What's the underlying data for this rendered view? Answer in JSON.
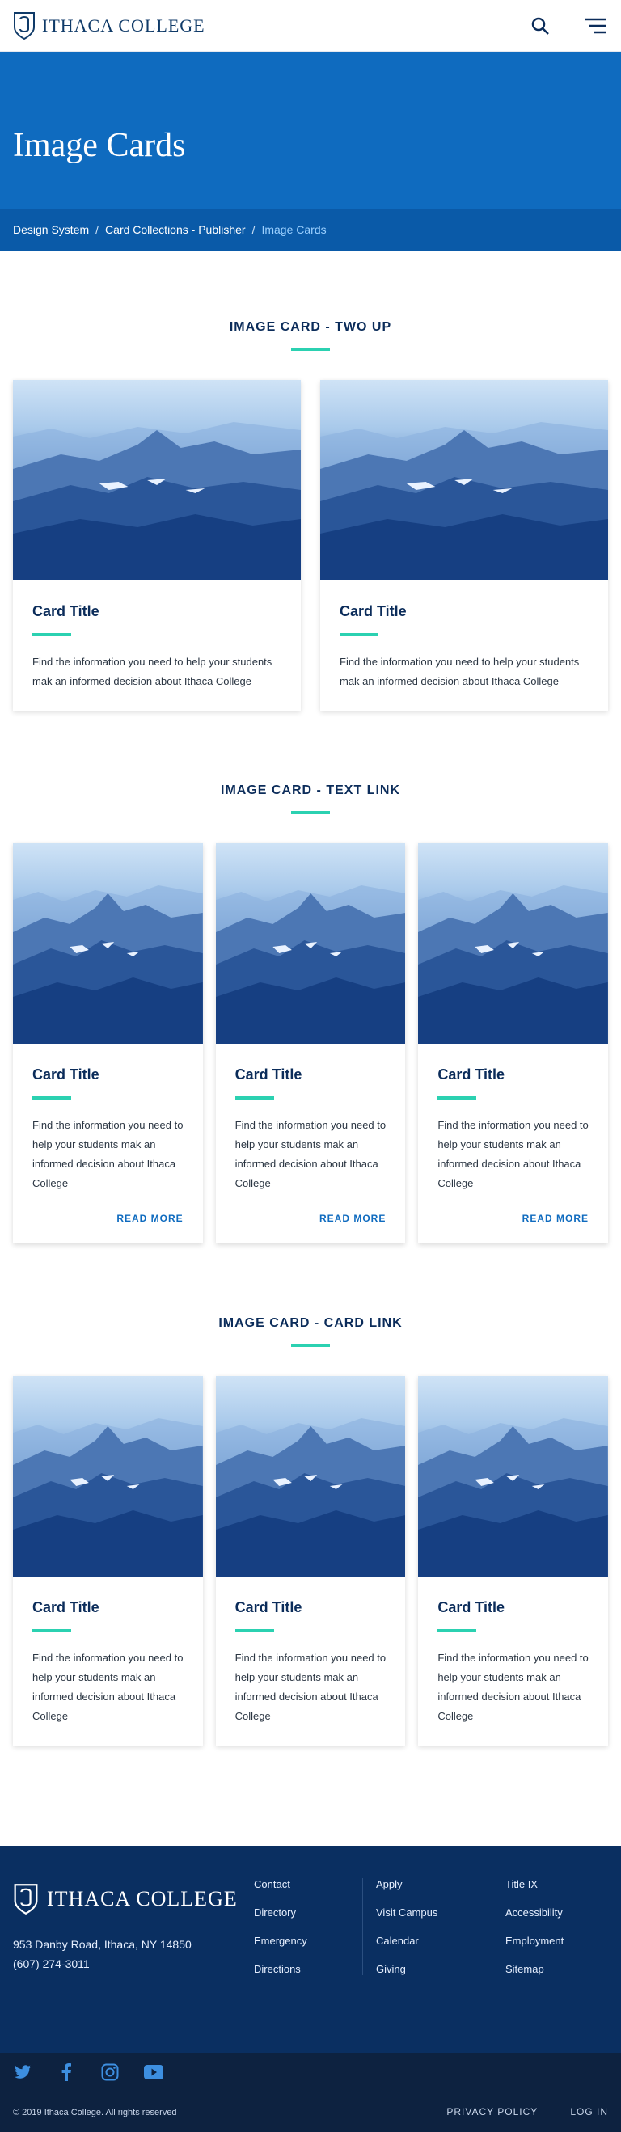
{
  "header": {
    "brand": "ITHACA COLLEGE",
    "search_icon": "search-icon",
    "menu_icon": "menu-icon"
  },
  "hero": {
    "title": "Image Cards"
  },
  "breadcrumb": {
    "items": [
      "Design System",
      "Card Collections - Publisher",
      "Image Cards"
    ],
    "sep": "/"
  },
  "sections": [
    {
      "title": "IMAGE CARD - TWO UP",
      "cards": [
        {
          "title": "Card Title",
          "text": "Find the information you need to help your students mak an informed decision about Ithaca College"
        },
        {
          "title": "Card Title",
          "text": "Find the information you need to help your students mak an informed decision about Ithaca College"
        }
      ]
    },
    {
      "title": "IMAGE CARD - TEXT LINK",
      "cards": [
        {
          "title": "Card Title",
          "text": "Find the information you need to help your students mak an informed decision about Ithaca College",
          "link": "READ MORE"
        },
        {
          "title": "Card Title",
          "text": "Find the information you need to help your students mak an informed decision about Ithaca College",
          "link": "READ MORE"
        },
        {
          "title": "Card Title",
          "text": "Find the information you need to help your students mak an informed decision about Ithaca College",
          "link": "READ MORE"
        }
      ]
    },
    {
      "title": "IMAGE CARD - CARD LINK",
      "cards": [
        {
          "title": "Card Title",
          "text": "Find the information you need to help your students mak an informed decision about Ithaca College"
        },
        {
          "title": "Card Title",
          "text": "Find the information you need to help your students mak an informed decision about Ithaca College"
        },
        {
          "title": "Card Title",
          "text": "Find the information you need to help your students mak an informed decision about Ithaca College"
        }
      ]
    }
  ],
  "footer": {
    "brand": "ITHACA COLLEGE",
    "address1": "953 Danby Road, Ithaca, NY 14850",
    "address2": "(607) 274-3011",
    "col1": [
      "Contact",
      "Directory",
      "Emergency",
      "Directions"
    ],
    "col2": [
      "Apply",
      "Visit Campus",
      "Calendar",
      "Giving"
    ],
    "col3": [
      "Title IX",
      "Accessibility",
      "Employment",
      "Sitemap"
    ],
    "social": [
      "twitter-icon",
      "facebook-icon",
      "instagram-icon",
      "youtube-icon"
    ],
    "copyright": "© 2019 Ithaca College. All rights reserved",
    "privacy": "PRIVACY POLICY",
    "login": "LOG IN"
  },
  "colors": {
    "primary": "#0f6bbf",
    "navy": "#0a2f61",
    "accent": "#2bd1b1"
  }
}
